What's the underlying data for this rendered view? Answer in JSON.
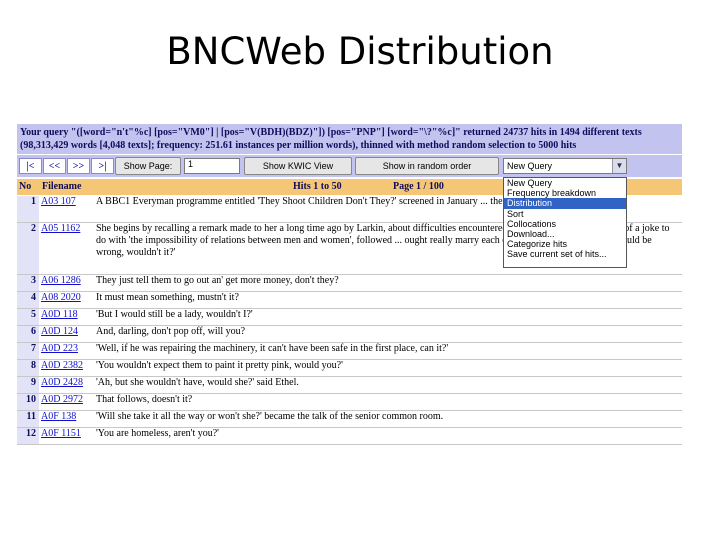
{
  "slide": {
    "title": "BNCWeb Distribution"
  },
  "query": {
    "line1": "Your query \"([word=\"n't\"%c] [pos=\"VM0\"] | [pos=\"V(BDH)(BDZ)\"]) [pos=\"PNP\"] [word=\"\\?\"%c]\" returned 24737 hits in 1494 different texts",
    "line2": "(98,313,429 words [4,048 texts]; frequency: 251.61 instances per million words), thinned with method random selection to 5000 hits"
  },
  "toolbar": {
    "nav_first": "|<",
    "nav_prev": "<<",
    "nav_next": ">>",
    "nav_last": ">|",
    "show_page": "Show Page:",
    "page_value": "1",
    "show_kwic": "Show KWIC View",
    "show_random": "Show in random order",
    "select_value": "New Query"
  },
  "dropdown": {
    "options": [
      "New Query",
      "Frequency breakdown",
      "Distribution",
      "Sort",
      "Collocations",
      "Download...",
      "Categorize hits",
      "Save current set of hits..."
    ],
    "selected": "Distribution"
  },
  "table": {
    "headers": {
      "no": "No",
      "filename": "Filename",
      "hits": "Hits 1 to 50",
      "page": "Page 1 / 100"
    },
    "rows": [
      {
        "no": "1",
        "file": "A03 107",
        "text": "A BBC1 Everyman programme entitled 'They Shoot Children Don't They?' screened in January ... the plight of the children."
      },
      {
        "no": "2",
        "file": "A05 1162",
        "text": "She begins by recalling a remark made to her a long time ago by Larkin, about difficulties encountered ... a remark which consisted of a joke to do with 'the impossibility of relations between men and women', followed ... ought really marry each other', followed by 'but that would be wrong, wouldn't it?'"
      },
      {
        "no": "3",
        "file": "A06 1286",
        "text": "They just tell them to go out an' get more money, don't they?"
      },
      {
        "no": "4",
        "file": "A08 2020",
        "text": "It must mean something, mustn't it?"
      },
      {
        "no": "5",
        "file": "A0D 118",
        "text": "'But I would still be a lady, wouldn't I?'"
      },
      {
        "no": "6",
        "file": "A0D 124",
        "text": "And, darling, don't pop off, will you?"
      },
      {
        "no": "7",
        "file": "A0D 223",
        "text": "'Well, if he was repairing the machinery, it can't have been safe in the first place, can it?'"
      },
      {
        "no": "8",
        "file": "A0D 2382",
        "text": "'You wouldn't expect them to paint it pretty pink, would you?'"
      },
      {
        "no": "9",
        "file": "A0D 2428",
        "text": "'Ah, but she wouldn't have, would she?' said Ethel."
      },
      {
        "no": "10",
        "file": "A0D 2972",
        "text": "That follows, doesn't it?"
      },
      {
        "no": "11",
        "file": "A0F 138",
        "text": "'Will she take it all the way or won't she?' became the talk of the senior common room."
      },
      {
        "no": "12",
        "file": "A0F 1151",
        "text": "'You are homeless, aren't you?'"
      }
    ]
  }
}
